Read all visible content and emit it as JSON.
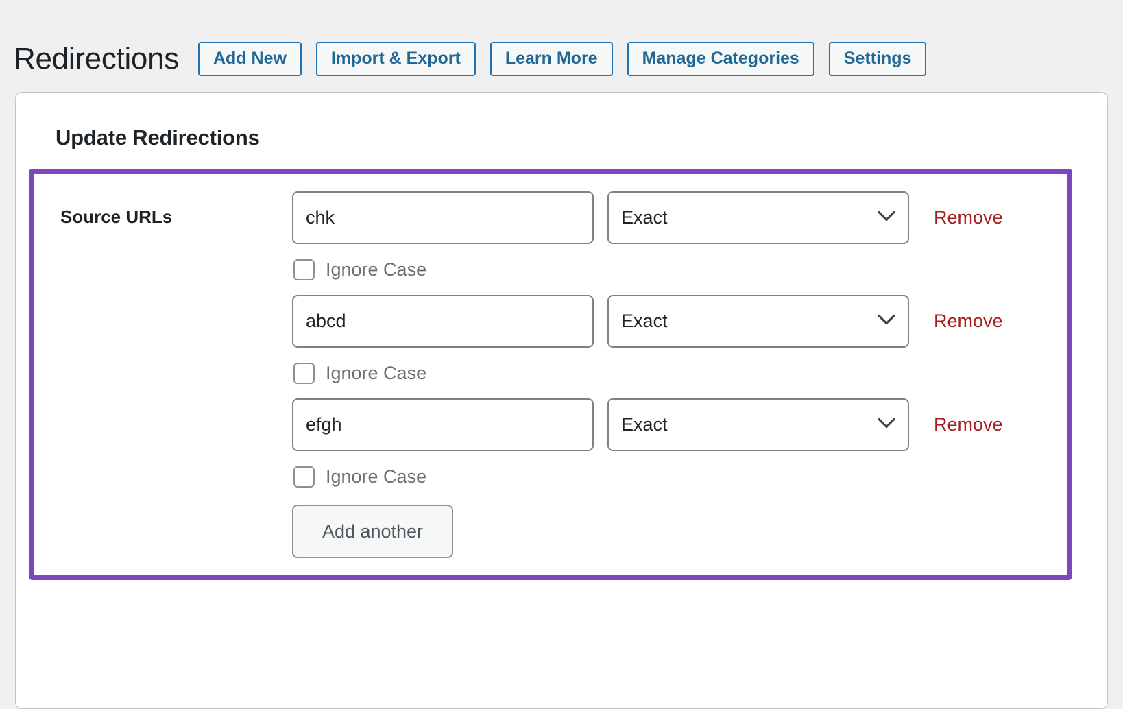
{
  "header": {
    "title": "Redirections",
    "buttons": [
      {
        "label": "Add New"
      },
      {
        "label": "Import & Export"
      },
      {
        "label": "Learn More"
      },
      {
        "label": "Manage Categories"
      },
      {
        "label": "Settings"
      }
    ]
  },
  "panel": {
    "title": "Update Redirections",
    "source_urls": {
      "label": "Source URLs",
      "rows": [
        {
          "url_value": "chk",
          "url_placeholder": "",
          "match_type": "Exact",
          "remove_label": "Remove",
          "ignore_case_label": "Ignore Case",
          "ignore_case_checked": false
        },
        {
          "url_value": "abcd",
          "url_placeholder": "",
          "match_type": "Exact",
          "remove_label": "Remove",
          "ignore_case_label": "Ignore Case",
          "ignore_case_checked": false
        },
        {
          "url_value": "efgh",
          "url_placeholder": "",
          "match_type": "Exact",
          "remove_label": "Remove",
          "ignore_case_label": "Ignore Case",
          "ignore_case_checked": false
        }
      ],
      "add_another_label": "Add another"
    }
  },
  "colors": {
    "page_background": "#f0f0f1",
    "card_background": "#ffffff",
    "card_border": "#c3c4c7",
    "button_border": "#2271b1",
    "button_text": "#1f6795",
    "highlight_border": "#7f46c0",
    "remove_link": "#a81d1d",
    "muted_text": "#6b6f76",
    "heading_text": "#1d2327"
  }
}
